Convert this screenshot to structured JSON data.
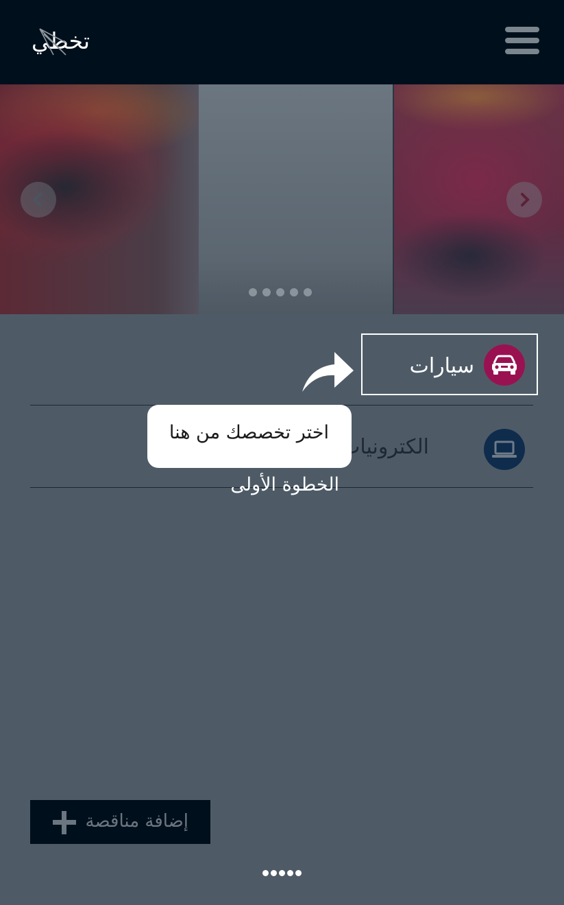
{
  "header": {
    "logo_text": "تخطي",
    "menu_icon": "hamburger-menu-icon"
  },
  "carousel": {
    "prev_icon": "chevron-left-icon",
    "next_icon": "chevron-right-icon",
    "slide_count": 5
  },
  "categories": [
    {
      "label": "سيارات",
      "icon": "car-icon",
      "color": "#9a1152",
      "highlighted": true
    },
    {
      "label": "الكترونيات",
      "icon": "laptop-icon",
      "color": "#0f2c4d",
      "highlighted": false
    }
  ],
  "tutorial": {
    "tooltip": "اختر تخصصك من هنا",
    "step": "الخطوة الأولى",
    "arrow_icon": "curved-arrow-icon"
  },
  "add_button": {
    "label": "إضافة مناقصة",
    "icon": "plus-icon"
  },
  "pager": {
    "dot_count": 5
  },
  "colors": {
    "header_bg": "#000f1c",
    "page_bg": "#4e5b67",
    "accent_cars": "#9a1152",
    "accent_electronics": "#0f2c4d"
  }
}
